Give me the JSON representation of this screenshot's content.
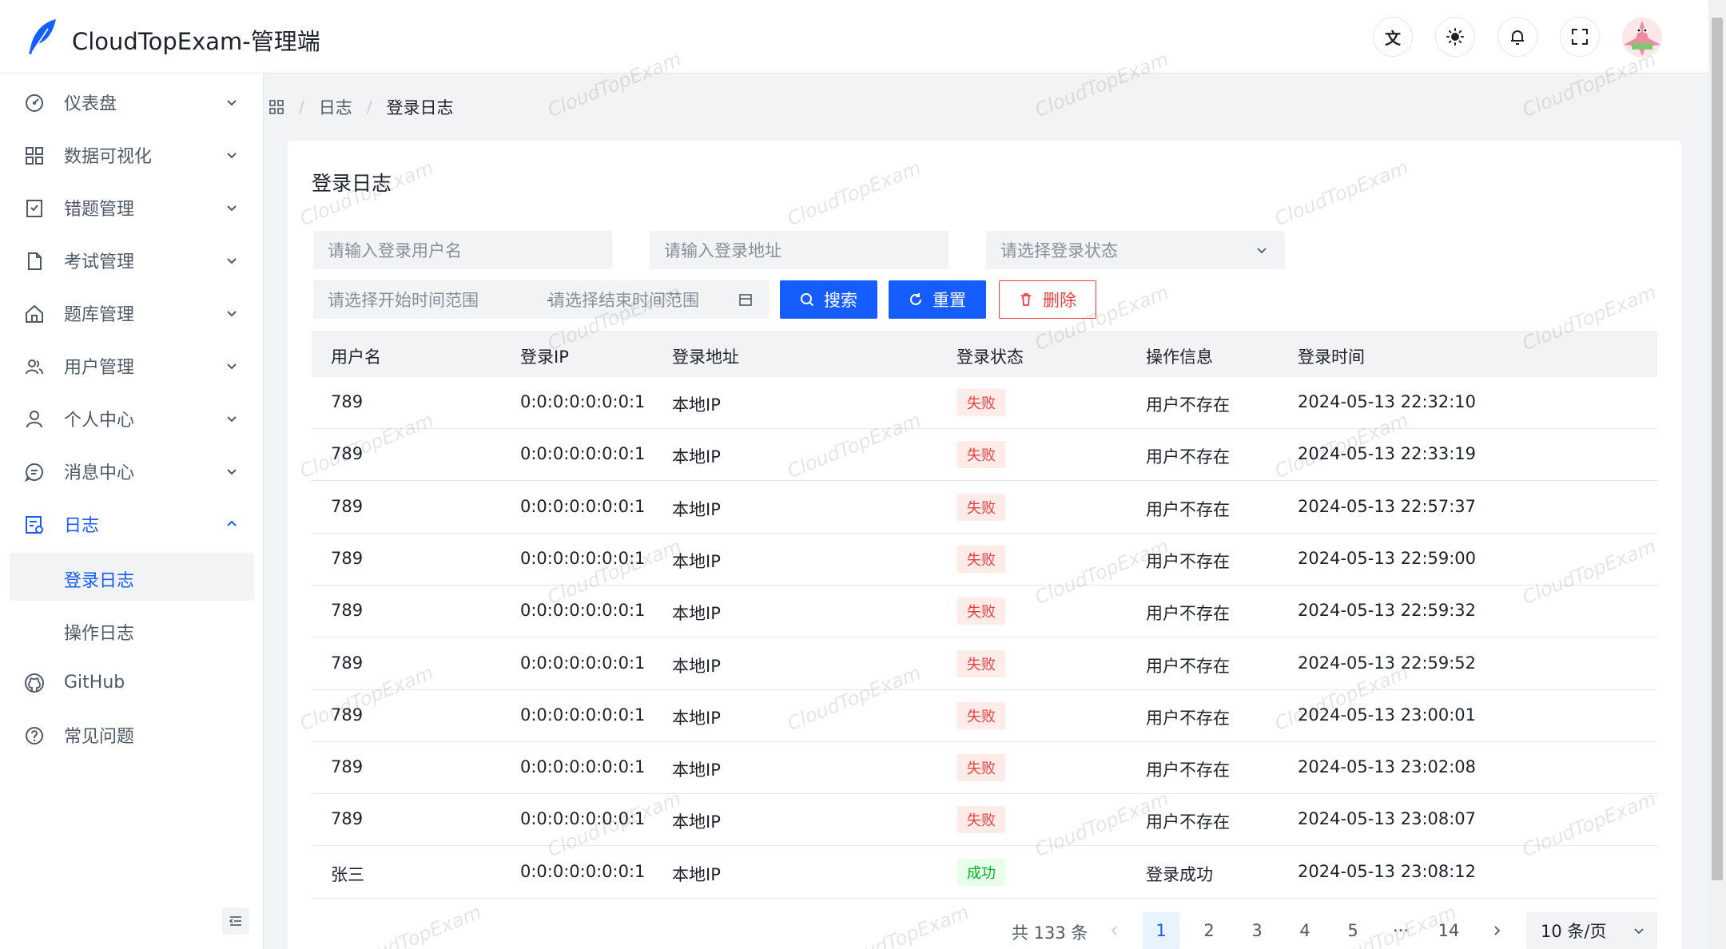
{
  "header": {
    "title": "CloudTopExam-管理端",
    "icons": [
      "translate-icon",
      "theme-icon",
      "bell-icon",
      "fullscreen-icon"
    ],
    "accent": "#165dff"
  },
  "sidebar": {
    "items": [
      {
        "label": "仪表盘",
        "icon": "dashboard-icon"
      },
      {
        "label": "数据可视化",
        "icon": "grid-icon"
      },
      {
        "label": "错题管理",
        "icon": "bookmark-check-icon"
      },
      {
        "label": "考试管理",
        "icon": "file-icon"
      },
      {
        "label": "题库管理",
        "icon": "home-icon"
      },
      {
        "label": "用户管理",
        "icon": "users-icon"
      },
      {
        "label": "个人中心",
        "icon": "user-icon"
      },
      {
        "label": "消息中心",
        "icon": "message-icon"
      },
      {
        "label": "日志",
        "icon": "log-icon"
      },
      {
        "label": "GitHub",
        "icon": "github-icon"
      },
      {
        "label": "常见问题",
        "icon": "question-icon"
      }
    ],
    "submenu": [
      {
        "label": "登录日志"
      },
      {
        "label": "操作日志"
      }
    ]
  },
  "breadcrumb": {
    "items": [
      "日志",
      "登录日志"
    ]
  },
  "main": {
    "title": "登录日志",
    "filters": {
      "username_placeholder": "请输入登录用户名",
      "address_placeholder": "请输入登录地址",
      "status_placeholder": "请选择登录状态",
      "start_placeholder": "请选择开始时间范围",
      "range_separator": "-",
      "end_placeholder": "请选择结束时间范围"
    },
    "buttons": {
      "search": "搜索",
      "reset": "重置",
      "delete": "删除"
    },
    "table": {
      "columns": [
        "用户名",
        "登录IP",
        "登录地址",
        "登录状态",
        "操作信息",
        "登录时间"
      ],
      "rows": [
        {
          "user": "789",
          "ip": "0:0:0:0:0:0:0:1",
          "address": "本地IP",
          "status": "失败",
          "status_type": "fail",
          "info": "用户不存在",
          "time": "2024-05-13 22:32:10"
        },
        {
          "user": "789",
          "ip": "0:0:0:0:0:0:0:1",
          "address": "本地IP",
          "status": "失败",
          "status_type": "fail",
          "info": "用户不存在",
          "time": "2024-05-13 22:33:19"
        },
        {
          "user": "789",
          "ip": "0:0:0:0:0:0:0:1",
          "address": "本地IP",
          "status": "失败",
          "status_type": "fail",
          "info": "用户不存在",
          "time": "2024-05-13 22:57:37"
        },
        {
          "user": "789",
          "ip": "0:0:0:0:0:0:0:1",
          "address": "本地IP",
          "status": "失败",
          "status_type": "fail",
          "info": "用户不存在",
          "time": "2024-05-13 22:59:00"
        },
        {
          "user": "789",
          "ip": "0:0:0:0:0:0:0:1",
          "address": "本地IP",
          "status": "失败",
          "status_type": "fail",
          "info": "用户不存在",
          "time": "2024-05-13 22:59:32"
        },
        {
          "user": "789",
          "ip": "0:0:0:0:0:0:0:1",
          "address": "本地IP",
          "status": "失败",
          "status_type": "fail",
          "info": "用户不存在",
          "time": "2024-05-13 22:59:52"
        },
        {
          "user": "789",
          "ip": "0:0:0:0:0:0:0:1",
          "address": "本地IP",
          "status": "失败",
          "status_type": "fail",
          "info": "用户不存在",
          "time": "2024-05-13 23:00:01"
        },
        {
          "user": "789",
          "ip": "0:0:0:0:0:0:0:1",
          "address": "本地IP",
          "status": "失败",
          "status_type": "fail",
          "info": "用户不存在",
          "time": "2024-05-13 23:02:08"
        },
        {
          "user": "789",
          "ip": "0:0:0:0:0:0:0:1",
          "address": "本地IP",
          "status": "失败",
          "status_type": "fail",
          "info": "用户不存在",
          "time": "2024-05-13 23:08:07"
        },
        {
          "user": "张三",
          "ip": "0:0:0:0:0:0:0:1",
          "address": "本地IP",
          "status": "成功",
          "status_type": "ok",
          "info": "登录成功",
          "time": "2024-05-13 23:08:12"
        }
      ]
    },
    "pagination": {
      "total": "共 133 条",
      "pages": [
        "1",
        "2",
        "3",
        "4",
        "5",
        "···",
        "14"
      ],
      "current": "1",
      "page_size": "10 条/页"
    }
  },
  "watermark": "CloudTopExam"
}
